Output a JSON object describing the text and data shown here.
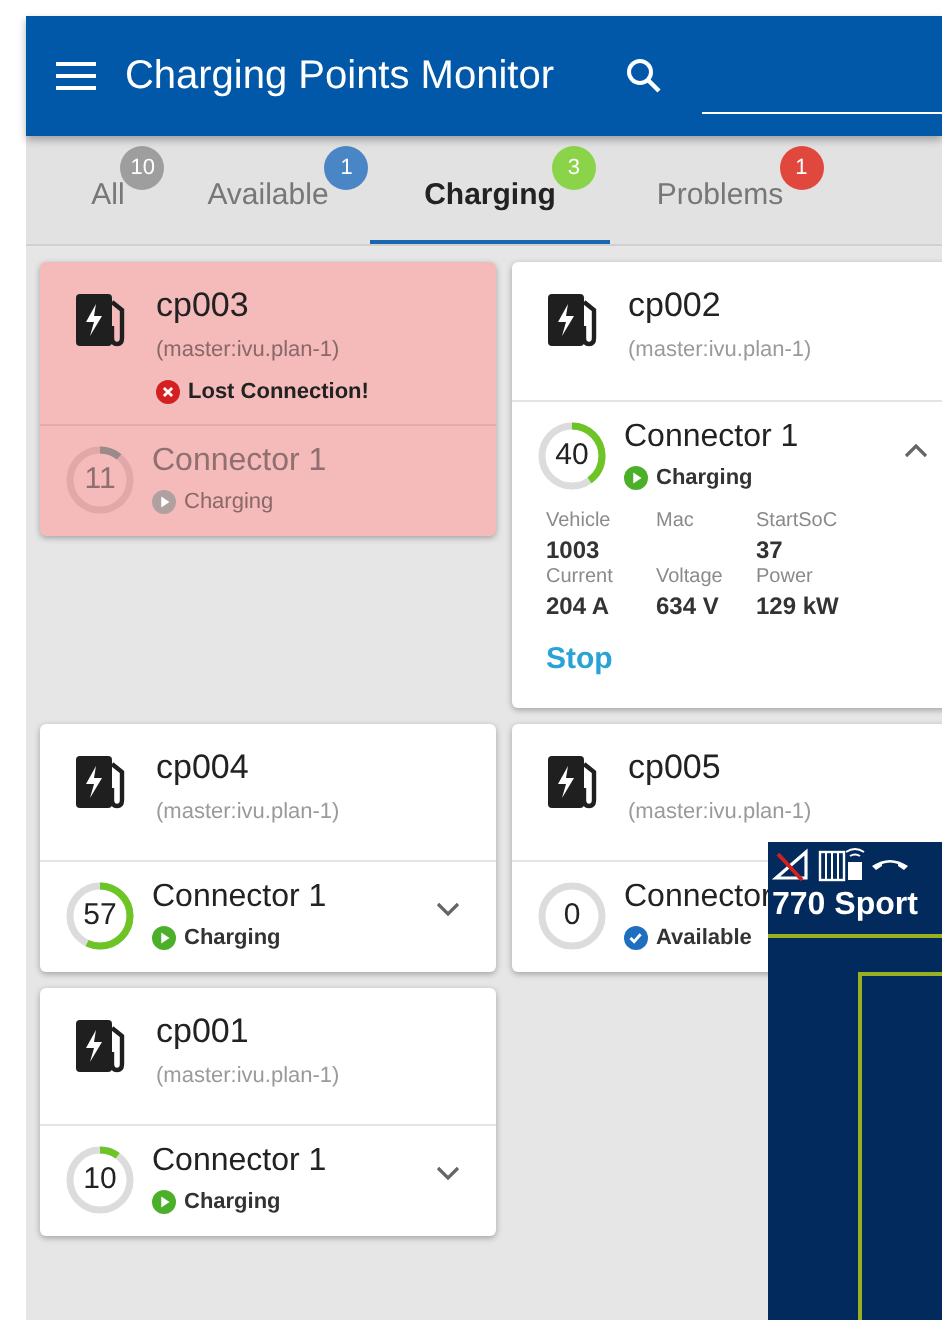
{
  "app_bar": {
    "title": "Charging Points Monitor"
  },
  "tabs": [
    {
      "label": "All",
      "count": "10",
      "color": "#9e9e9e",
      "selected": false
    },
    {
      "label": "Available",
      "count": "1",
      "color": "#4a86c5",
      "selected": false
    },
    {
      "label": "Charging",
      "count": "3",
      "color": "#8bd44a",
      "selected": true
    },
    {
      "label": "Problems",
      "count": "1",
      "color": "#e0483e",
      "selected": false
    }
  ],
  "cards": [
    {
      "name": "cp003",
      "subtitle": "(master:ivu.plan-1)",
      "problem": true,
      "alert": "Lost Connection!",
      "connector": {
        "name": "Connector 1",
        "soc": "11",
        "level": 0.11,
        "status": "Charging",
        "kind": "charging"
      }
    },
    {
      "name": "cp002",
      "subtitle": "(master:ivu.plan-1)",
      "problem": false,
      "connector": {
        "name": "Connector 1",
        "soc": "40",
        "level": 0.4,
        "status": "Charging",
        "kind": "charging",
        "expanded": true,
        "details": [
          {
            "label": "Vehicle",
            "value": "1003"
          },
          {
            "label": "Mac"
          },
          {
            "label": "StartSoC",
            "value": "37"
          },
          {
            "label": "Current",
            "value": "204 A"
          },
          {
            "label": "Voltage",
            "value": "634 V"
          },
          {
            "label": "Power",
            "value": "129 kW"
          }
        ],
        "action": "Stop"
      }
    },
    {
      "name": "cp004",
      "subtitle": "(master:ivu.plan-1)",
      "problem": false,
      "connector": {
        "name": "Connector 1",
        "soc": "57",
        "level": 0.57,
        "status": "Charging",
        "kind": "charging",
        "expanded": false
      }
    },
    {
      "name": "cp005",
      "subtitle": "(master:ivu.plan-1)",
      "problem": false,
      "connector": {
        "name": "Connector",
        "soc": "0",
        "level": 0,
        "status": "Available",
        "kind": "available"
      }
    },
    {
      "name": "cp001",
      "subtitle": "(master:ivu.plan-1)",
      "problem": false,
      "connector": {
        "name": "Connector 1",
        "soc": "10",
        "level": 0.1,
        "status": "Charging",
        "kind": "charging",
        "expanded": false
      }
    }
  ],
  "overlay": {
    "title": "770 Sport"
  }
}
